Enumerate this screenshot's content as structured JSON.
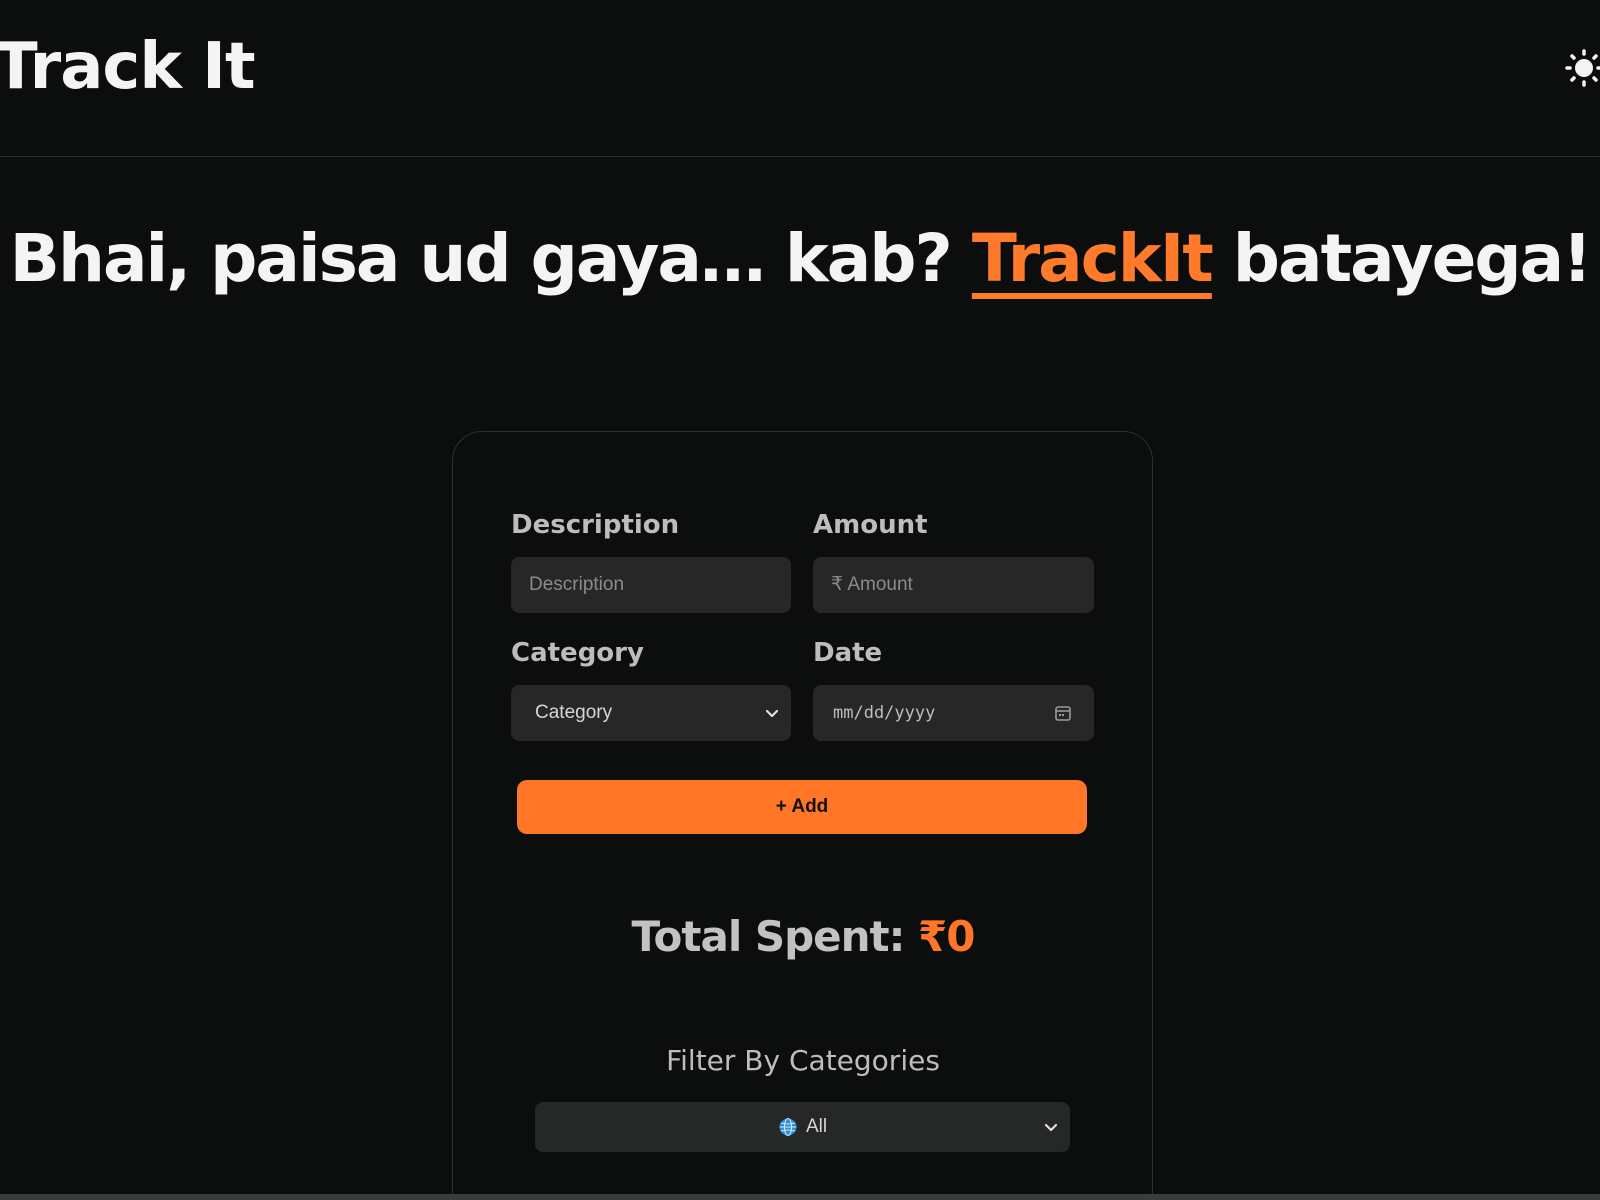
{
  "header": {
    "brand": "Track It",
    "theme_toggle_icon": "sun-icon"
  },
  "hero": {
    "before": "Bhai, paisa ud gaya… kab?",
    "accent": "TrackIt",
    "after": "batayega!"
  },
  "form": {
    "description_label": "Description",
    "description_placeholder": "Description",
    "amount_label": "Amount",
    "amount_placeholder": "₹ Amount",
    "category_label": "Category",
    "category_selected": "Category",
    "date_label": "Date",
    "date_placeholder": "mm/dd/yyyy",
    "add_button": "+ Add"
  },
  "summary": {
    "total_label": "Total Spent:",
    "total_value": "₹0"
  },
  "filter": {
    "title": "Filter By Categories",
    "selected": "All",
    "selected_icon": "globe-icon"
  },
  "colors": {
    "background": "#0c0d0d",
    "accent": "#ff7627",
    "field_bg": "#272727"
  }
}
